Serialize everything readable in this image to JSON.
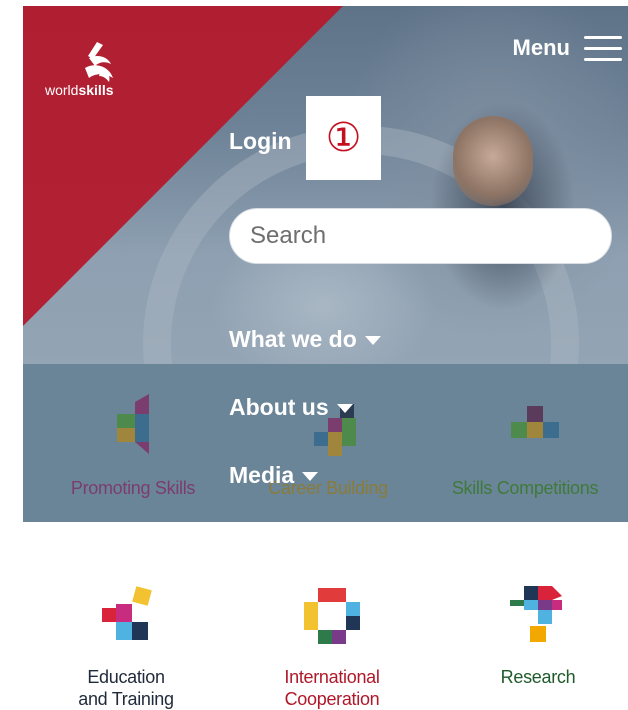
{
  "header": {
    "logo_text_light": "world",
    "logo_text_bold": "skills",
    "menu_label": "Menu"
  },
  "nav": {
    "login_label": "Login",
    "annotation_marker": "①",
    "search_placeholder": "Search",
    "items": [
      {
        "label": "What we do"
      },
      {
        "label": "About us"
      },
      {
        "label": "Media"
      }
    ]
  },
  "tiles": [
    {
      "label": "Promoting Skills",
      "color": "#7b3d6e"
    },
    {
      "label": "Career Building",
      "color": "#8a7b3a"
    },
    {
      "label": "Skills Competitions",
      "color": "#3f7a3a"
    }
  ],
  "bottom_tiles": [
    {
      "label": "Education\nand Training",
      "color": "#1f2a3a"
    },
    {
      "label": "International\nCooperation",
      "color": "#b0182a"
    },
    {
      "label": "Research",
      "color": "#1f5a2a"
    }
  ],
  "colors": {
    "brand_red": "#b31b2e",
    "overlay": "#6b8598",
    "white": "#ffffff"
  },
  "icons": [
    "hamburger-icon",
    "worldskills-logo",
    "caret-down-icon"
  ]
}
